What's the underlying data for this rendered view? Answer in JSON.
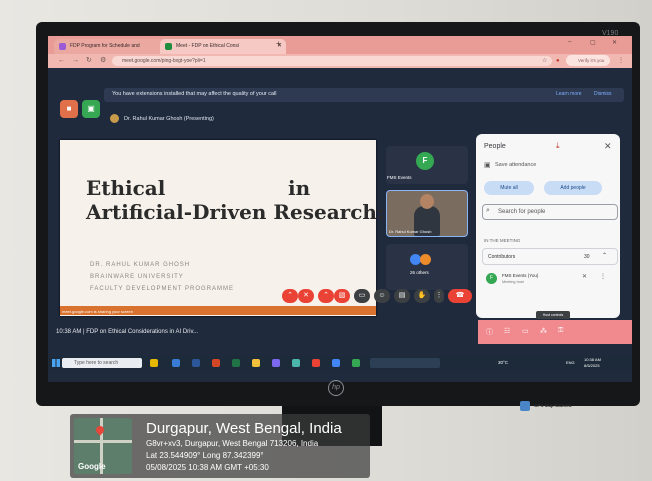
{
  "monitor": {
    "brand": "V190",
    "logo": "hp"
  },
  "browser": {
    "tabs": [
      {
        "label": "FDP Program for Schedule and"
      },
      {
        "label": "Meet - FDP on Ethical Consi"
      }
    ],
    "url": "meet.google.com/ping-bxgt-yoe?pli=1",
    "profile_label": "Verify it's you"
  },
  "meet": {
    "extension_notice": "You have extensions installed that may affect the quality of your call",
    "learn_more": "Learn more",
    "dismiss": "Dismiss",
    "presenter": "Dr. Rahul Kumar Ghosh (Presenting)",
    "slide": {
      "title_line1": "Ethical",
      "title_in": "in",
      "title_line2": "Artificial-Driven Research:",
      "author": "DR. RAHUL KUMAR GHOSH",
      "university": "BRAINWARE UNIVERSITY",
      "programme": "FACULTY DEVELOPMENT PROGRAMME",
      "footer": "meet.google.com is sharing your screen"
    },
    "tiles": {
      "fms_initial": "F",
      "fms_name": "FMS Events",
      "cam_name": "Dr. Rahul Kumar Ghosh",
      "others": "26 others"
    },
    "people": {
      "title": "People",
      "save_attendance": "Save attendance",
      "mute_all": "Mute all",
      "add_people": "Add people",
      "search_placeholder": "Search for people",
      "in_meeting": "IN THE MEETING",
      "contributors_label": "Contributors",
      "contributors_count": "30",
      "member_initial": "F",
      "member_name": "FMS Events (You)",
      "member_sub": "Meeting host"
    },
    "meeting_time": "10:38 AM | FDP on Ethical Considerations in AI Driv...",
    "host_controls_tip": "Host controls"
  },
  "taskbar": {
    "search_placeholder": "Type here to search",
    "weather": "30°C",
    "lang": "ENG",
    "time": "10:38 AM",
    "date": "8/5/2025"
  },
  "gps": {
    "camera_label": "GPS Map Camera",
    "city": "Durgapur, West Bengal, India",
    "address": "G8vr+xv3, Durgapur, West Bengal 713206, India",
    "coords": "Lat 23.544909° Long 87.342399°",
    "datetime": "05/08/2025 10:38 AM GMT +05:30",
    "map_brand": "Google"
  }
}
